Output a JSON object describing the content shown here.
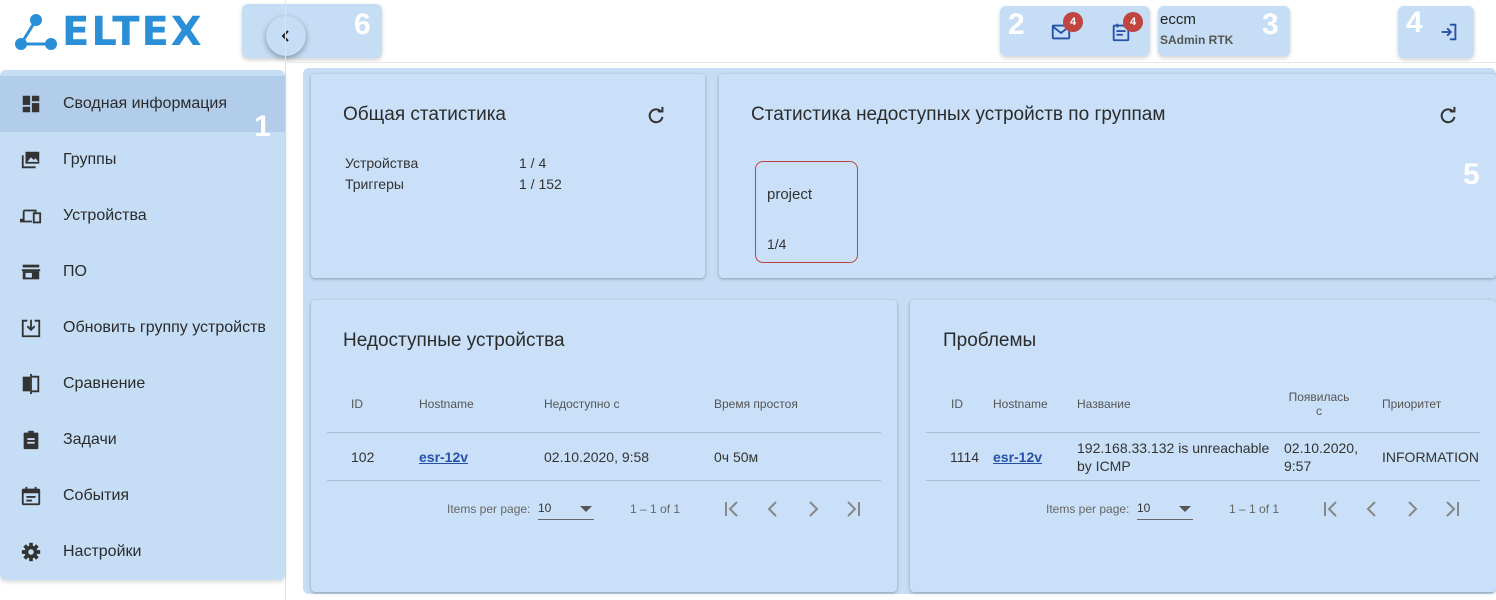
{
  "brand": {
    "logo_text": "ELTEX",
    "logo_color": "#2a8fd6"
  },
  "callouts": {
    "n1": "1",
    "n2": "2",
    "n3": "3",
    "n4": "4",
    "n5": "5",
    "n6": "6"
  },
  "header": {
    "mail_badge": "4",
    "events_badge": "4",
    "user_name": "eccm",
    "user_role": "SAdmin RTK"
  },
  "sidebar": {
    "items": [
      {
        "label": "Сводная информация",
        "icon": "dashboard-icon",
        "active": true
      },
      {
        "label": "Группы",
        "icon": "groups-icon"
      },
      {
        "label": "Устройства",
        "icon": "devices-icon"
      },
      {
        "label": "ПО",
        "icon": "store-icon"
      },
      {
        "label": "Обновить группу устройств",
        "icon": "download-box-icon"
      },
      {
        "label": "Сравнение",
        "icon": "compare-icon"
      },
      {
        "label": "Задачи",
        "icon": "assignment-icon"
      },
      {
        "label": "События",
        "icon": "event-icon"
      },
      {
        "label": "Настройки",
        "icon": "gear-icon"
      }
    ]
  },
  "general_stats": {
    "title": "Общая статистика",
    "rows": [
      {
        "label": "Устройства",
        "value": "1 / 4"
      },
      {
        "label": "Триггеры",
        "value": "1 / 152"
      }
    ]
  },
  "group_stats": {
    "title": "Статистика недоступных устройств по группам",
    "groups": [
      {
        "name": "project",
        "value": "1/4"
      }
    ]
  },
  "unavailable": {
    "title": "Недоступные устройства",
    "columns": [
      "ID",
      "Hostname",
      "Недоступно с",
      "Время простоя"
    ],
    "rows": [
      {
        "id": "102",
        "hostname": "esr-12v",
        "since": "02.10.2020, 9:58",
        "downtime": "0ч 50м"
      }
    ],
    "pager": {
      "label": "Items per page:",
      "size": "10",
      "range": "1 – 1 of 1"
    }
  },
  "problems": {
    "title": "Проблемы",
    "columns": [
      "ID",
      "Hostname",
      "Название",
      "Появилась с",
      "Приоритет"
    ],
    "col_appeared_line1": "Появилась",
    "col_appeared_line2": "с",
    "rows": [
      {
        "id": "1114",
        "hostname": "esr-12v",
        "name_line1": "192.168.33.132 is unreachable",
        "name_line2": "by ICMP",
        "appeared_line1": "02.10.2020,",
        "appeared_line2": "9:57",
        "priority": "INFORMATION"
      }
    ],
    "pager": {
      "label": "Items per page:",
      "size": "10",
      "range": "1 – 1 of 1"
    }
  },
  "colors": {
    "panel": "#c5ddf5",
    "card": "#c9e0f8",
    "badge": "#c0443f",
    "link": "#2750a8",
    "group_border": "#c0443f"
  }
}
